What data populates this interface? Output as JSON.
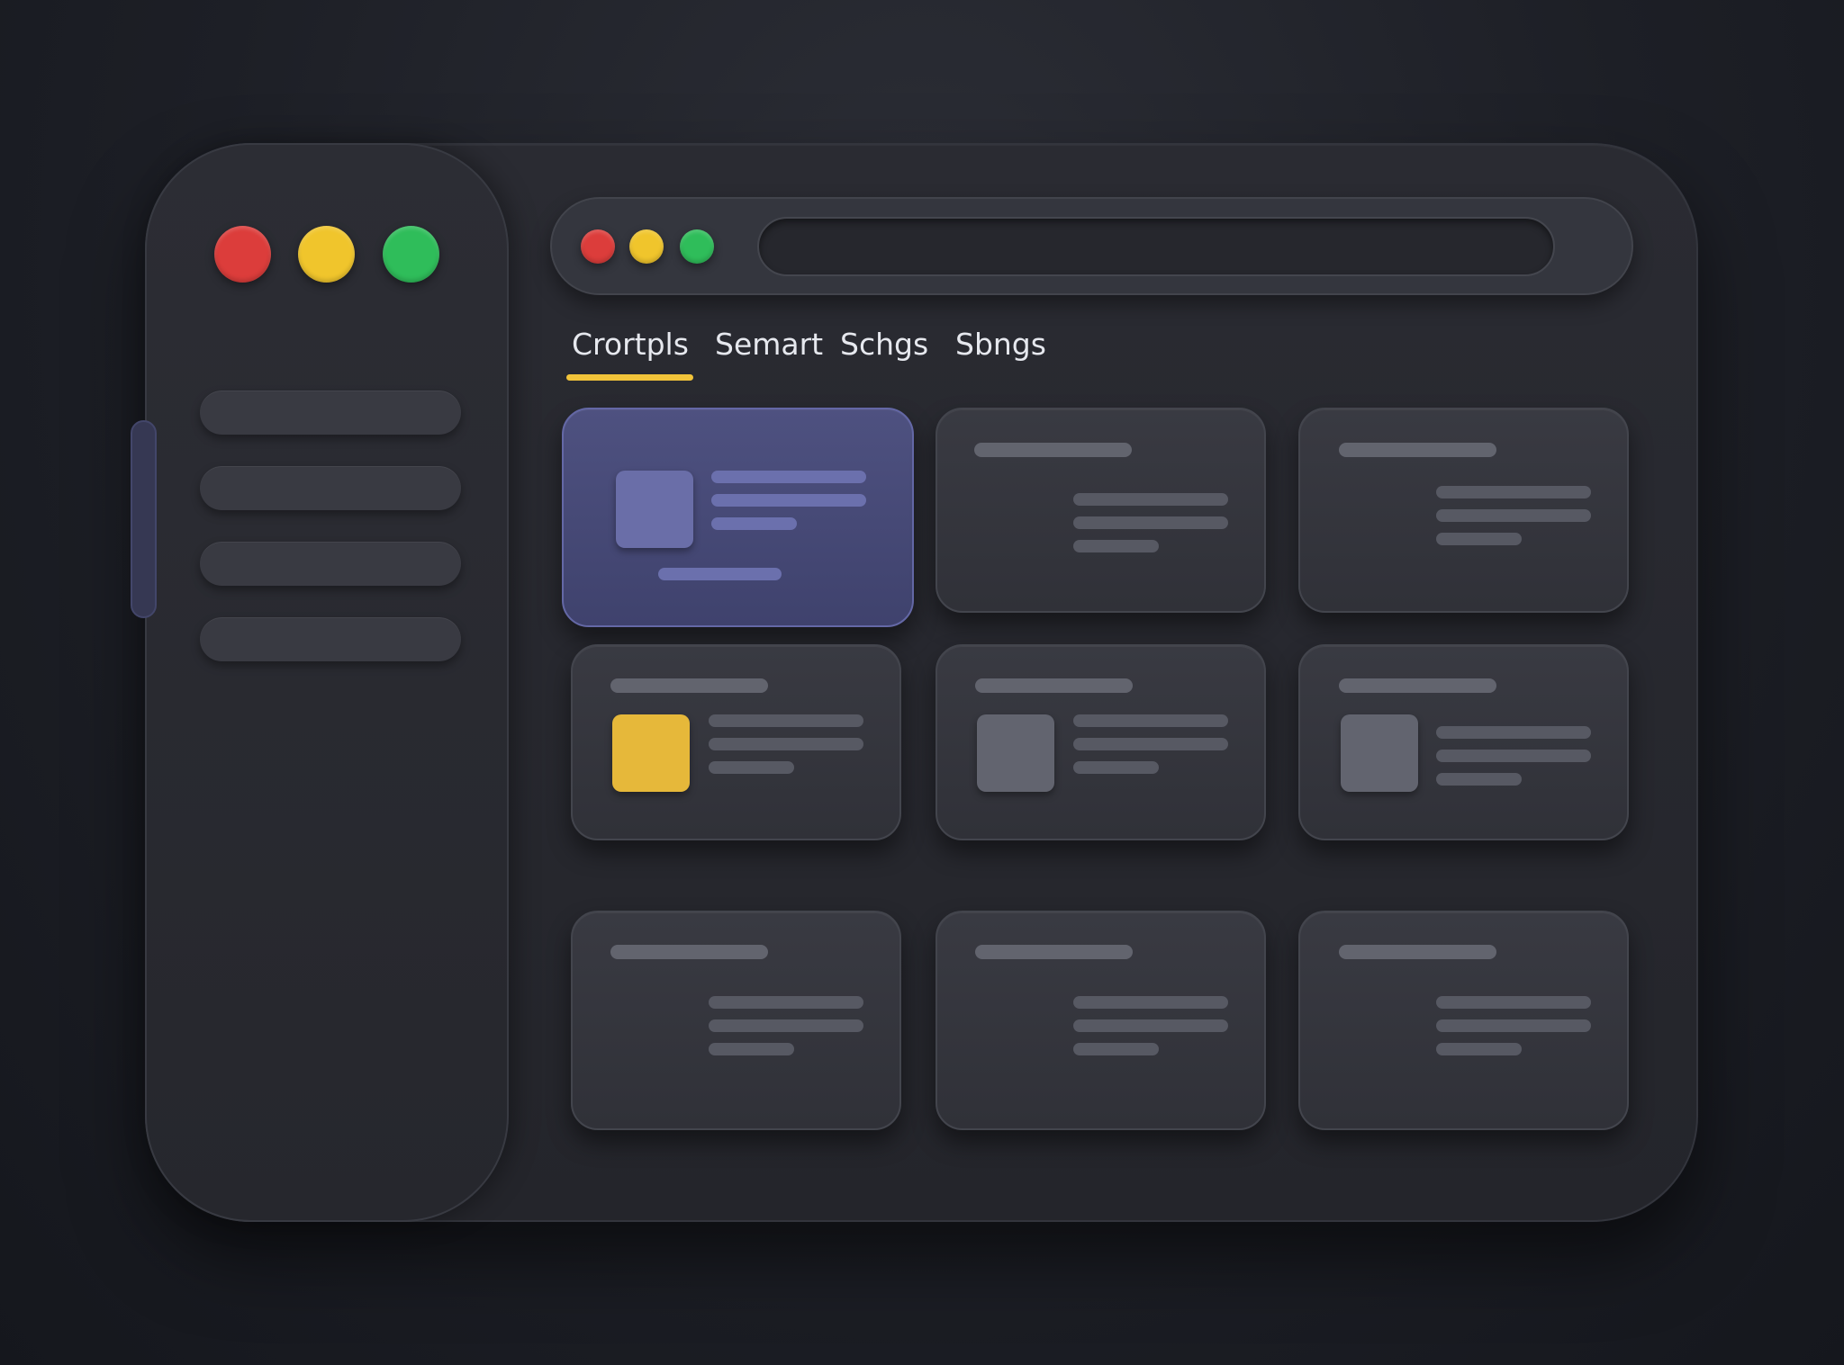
{
  "window": {
    "controls": [
      "close",
      "minimize",
      "maximize"
    ],
    "colors": {
      "close": "#dc3d3b",
      "minimize": "#f0c52c",
      "maximize": "#2fbd5a"
    }
  },
  "sidebar": {
    "items": [
      {
        "icon": "sidebar-item"
      },
      {
        "icon": "sidebar-item"
      },
      {
        "icon": "sidebar-item"
      },
      {
        "icon": "sidebar-item"
      }
    ]
  },
  "toolbar": {
    "address": {
      "value": "",
      "placeholder": ""
    }
  },
  "tabs": [
    {
      "label": "Crortpls",
      "active": true
    },
    {
      "label": "Semart",
      "active": false
    },
    {
      "label": "Schgs",
      "active": false
    },
    {
      "label": "Sbngs",
      "active": false
    }
  ],
  "accent_colors": {
    "tab_underline": "#f2c43a",
    "selected_card": "#4a4d7a",
    "accent_thumbnail": "#e6b83a"
  },
  "cards": [
    {
      "thumbnail": true,
      "selected": true
    },
    {
      "thumbnail": false,
      "selected": false
    },
    {
      "thumbnail": false,
      "selected": false
    },
    {
      "thumbnail": true,
      "accent": true,
      "selected": false
    },
    {
      "thumbnail": true,
      "selected": false
    },
    {
      "thumbnail": true,
      "selected": false
    },
    {
      "thumbnail": false,
      "selected": false
    },
    {
      "thumbnail": false,
      "selected": false
    },
    {
      "thumbnail": false,
      "selected": false
    }
  ]
}
